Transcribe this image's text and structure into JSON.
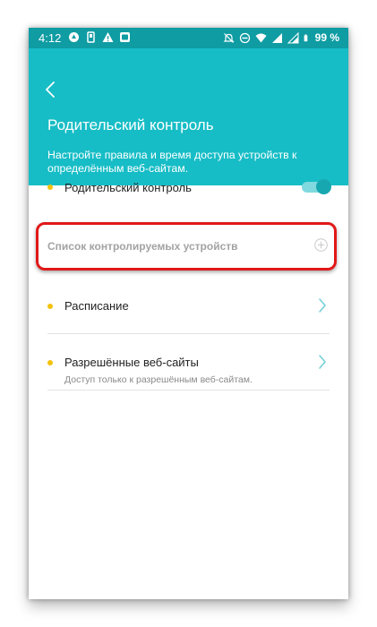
{
  "status_bar": {
    "time": "4:12",
    "battery": "99 %"
  },
  "header": {
    "back_icon": "chevron-left-icon",
    "title": "Родительский контроль",
    "subtitle": "Настройте правила и время доступа устройств к определённым веб-сайтам."
  },
  "settings": {
    "parental_control": {
      "label": "Родительский контроль",
      "enabled": true
    },
    "devices": {
      "label": "Список контролируемых устройств",
      "add_icon": "plus-circle-icon"
    },
    "schedule": {
      "label": "Расписание"
    },
    "allowed_sites": {
      "label": "Разрешённые веб-сайты",
      "sublabel": "Доступ только к разрешённым веб-сайтам."
    }
  },
  "colors": {
    "header": "#17bdc6",
    "status_bar": "#0f9ca3",
    "bullet": "#f3c20c",
    "highlight": "#e11818",
    "toggle_on": "#17a7b0"
  }
}
